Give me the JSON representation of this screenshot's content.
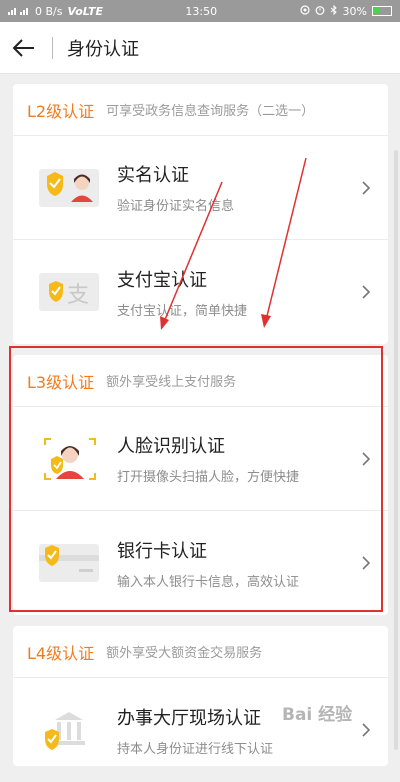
{
  "status_bar": {
    "left_text": "0 B/s",
    "network": "VoLTE",
    "time": "13:50",
    "battery": "30%",
    "battery_level": 0.3
  },
  "header": {
    "title": "身份认证"
  },
  "sections": [
    {
      "level": "L2级认证",
      "desc": "可享受政务信息查询服务（二选一）",
      "items": [
        {
          "title": "实名认证",
          "sub": "验证身份证实名信息",
          "icon": "id-card-icon"
        },
        {
          "title": "支付宝认证",
          "sub": "支付宝认证，简单快捷",
          "icon": "alipay-icon"
        }
      ]
    },
    {
      "level": "L3级认证",
      "desc": "额外享受线上支付服务",
      "items": [
        {
          "title": "人脸识别认证",
          "sub": "打开摄像头扫描人脸，方便快捷",
          "icon": "face-scan-icon"
        },
        {
          "title": "银行卡认证",
          "sub": "输入本人银行卡信息，高效认证",
          "icon": "bank-card-icon"
        }
      ]
    },
    {
      "level": "L4级认证",
      "desc": "额外享受大额资金交易服务",
      "items": [
        {
          "title": "办事大厅现场认证",
          "sub": "持本人身份证进行线下认证",
          "icon": "service-hall-icon"
        }
      ]
    }
  ],
  "watermark": "Bai 经验",
  "colors": {
    "accent": "#f07c1f",
    "highlight": "#e03030",
    "shield": "#f5b918"
  }
}
